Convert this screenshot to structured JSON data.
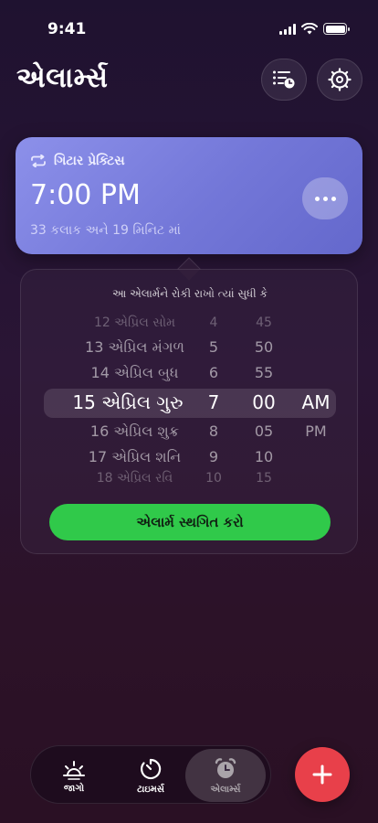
{
  "status": {
    "time": "9:41"
  },
  "header": {
    "title": "એલાર્મ્સ",
    "list_icon": "alarm-list-icon",
    "settings_icon": "gear-icon"
  },
  "alarm": {
    "label": "ગિટાર પ્રેક્ટિસ",
    "time": "7:00 PM",
    "countdown": "33 કલાક અને 19 મિનિટ માં",
    "repeat_icon": "repeat-icon",
    "more_icon": "ellipsis-icon"
  },
  "snooze_popover": {
    "title": "આ એલાર્મને રોકી રાખો ત્યાં સુધી કે",
    "rows": [
      {
        "date": "12 એપ્રિલ સોમ",
        "hour": "4",
        "minute": "45",
        "ampm": ""
      },
      {
        "date": "13 એપ્રિલ મંગળ",
        "hour": "5",
        "minute": "50",
        "ampm": ""
      },
      {
        "date": "14 એપ્રિલ બુધ",
        "hour": "6",
        "minute": "55",
        "ampm": ""
      },
      {
        "date": "15 એપ્રિલ ગુરુ",
        "hour": "7",
        "minute": "00",
        "ampm": "AM"
      },
      {
        "date": "16 એપ્રિલ શુક્ર",
        "hour": "8",
        "minute": "05",
        "ampm": "PM"
      },
      {
        "date": "17 એપ્રિલ શનિ",
        "hour": "9",
        "minute": "10",
        "ampm": ""
      },
      {
        "date": "18 એપ્રિલ રવિ",
        "hour": "10",
        "minute": "15",
        "ampm": ""
      }
    ],
    "button_label": "એલાર્મ સ્થગિત કરો"
  },
  "tabs": [
    {
      "label": "જાગો",
      "icon": "sunrise-icon"
    },
    {
      "label": "ટાઇમર્સ",
      "icon": "timer-icon"
    },
    {
      "label": "એલાર્મ્સ",
      "icon": "alarm-clock-icon"
    }
  ],
  "add_icon": "plus-icon",
  "colors": {
    "card": "#7d82e0",
    "snooze_button": "#30c94a",
    "add_button": "#e8404a"
  }
}
